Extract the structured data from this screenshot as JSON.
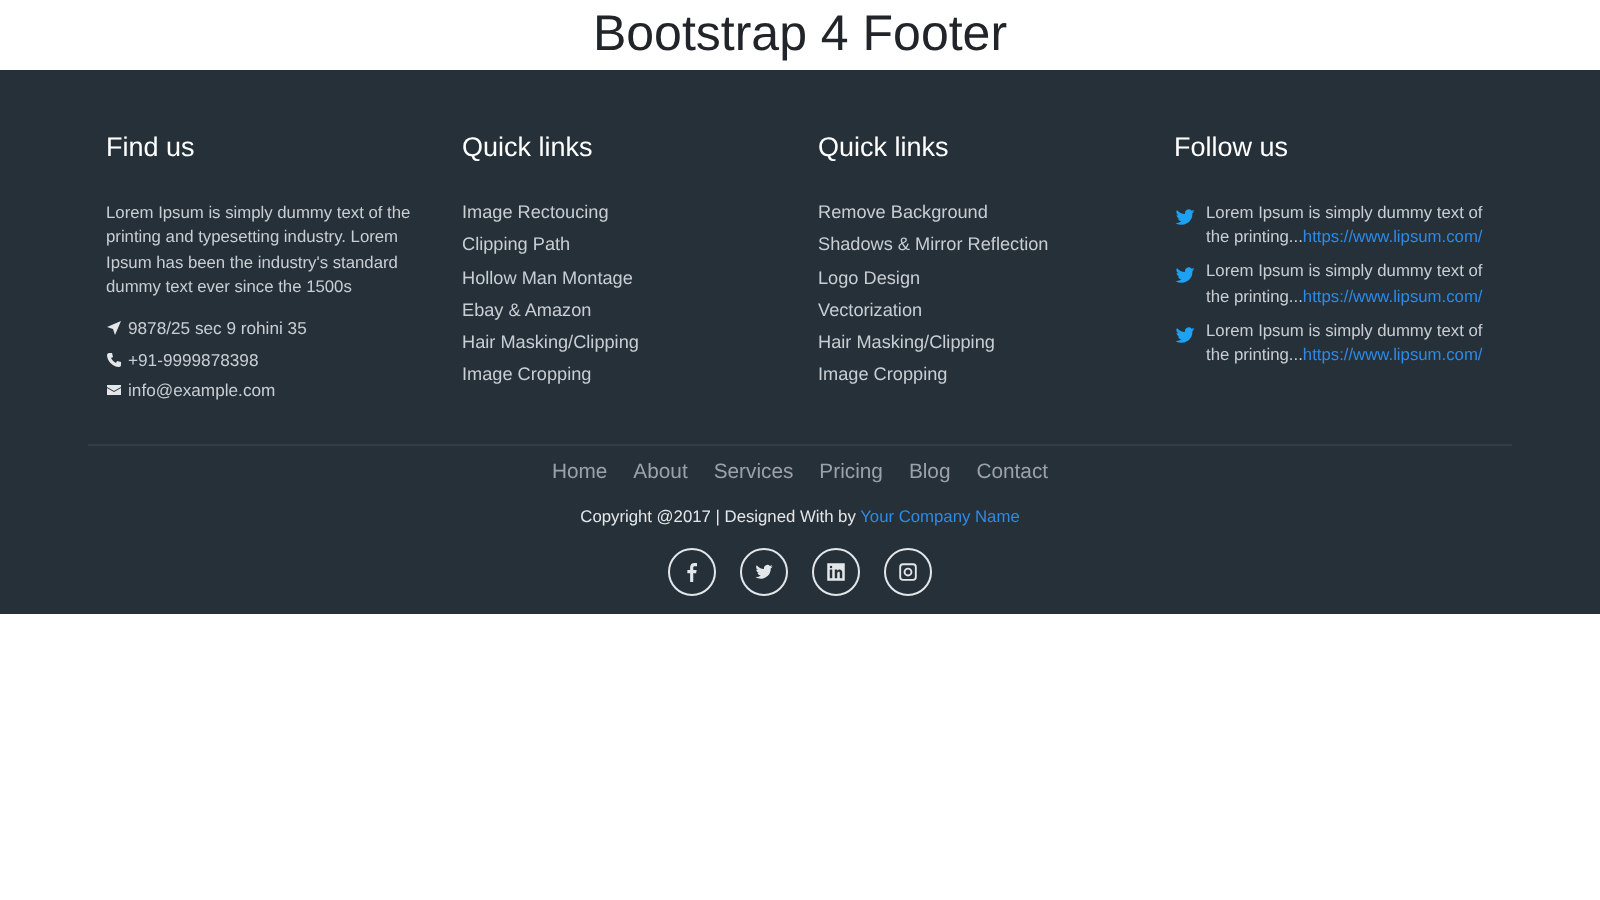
{
  "page_title": "Bootstrap 4 Footer",
  "find_us": {
    "heading": "Find us",
    "text": "Lorem Ipsum is simply dummy text of the printing and typesetting industry. Lorem Ipsum has been the industry's standard dummy text ever since the 1500s",
    "contacts": [
      {
        "kind": "address",
        "text": "9878/25 sec 9 rohini 35"
      },
      {
        "kind": "phone",
        "text": "+91-9999878398"
      },
      {
        "kind": "email",
        "text": "info@example.com"
      }
    ]
  },
  "quick_links_1": {
    "heading": "Quick links",
    "links": [
      "Image Rectoucing",
      "Clipping Path",
      "Hollow Man Montage",
      "Ebay & Amazon",
      "Hair Masking/Clipping",
      "Image Cropping"
    ]
  },
  "quick_links_2": {
    "heading": "Quick links",
    "links": [
      "Remove Background",
      "Shadows & Mirror Reflection",
      "Logo Design",
      "Vectorization",
      "Hair Masking/Clipping",
      "Image Cropping"
    ]
  },
  "follow_us": {
    "heading": "Follow us",
    "tweets": [
      {
        "text": "Lorem Ipsum is simply dummy text of the printing...",
        "link": "https://www.lipsum.com/"
      },
      {
        "text": "Lorem Ipsum is simply dummy text of the printing...",
        "link": "https://www.lipsum.com/"
      },
      {
        "text": "Lorem Ipsum is simply dummy text of the printing...",
        "link": "https://www.lipsum.com/"
      }
    ]
  },
  "bottom_nav": [
    "Home",
    "About",
    "Services",
    "Pricing",
    "Blog",
    "Contact"
  ],
  "copyright": {
    "text": "Copyright @2017 | Designed With by ",
    "link": "Your Company Name"
  },
  "social": [
    {
      "kind": "facebook"
    },
    {
      "kind": "twitter"
    },
    {
      "kind": "linkedin"
    },
    {
      "kind": "instagram"
    }
  ]
}
